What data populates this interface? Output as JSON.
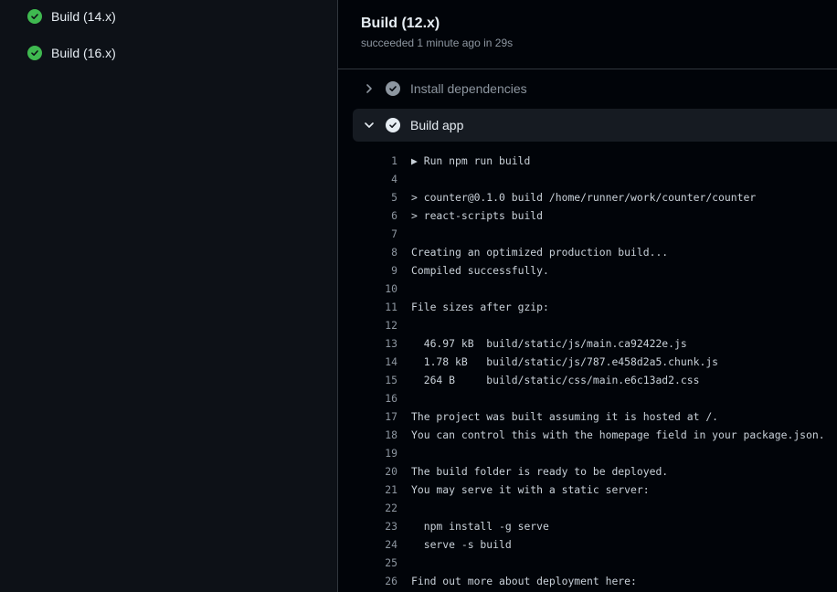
{
  "sidebar": {
    "jobs": [
      {
        "label": "Build (14.x)"
      },
      {
        "label": "Build (16.x)"
      }
    ]
  },
  "colors": {
    "success": "#3fb950",
    "background": "#010409",
    "sidebar_bg": "#0d1117",
    "border": "#30363d",
    "muted": "#8d96a0"
  },
  "header": {
    "title": "Build (12.x)",
    "subtitle": "succeeded 1 minute ago in 29s"
  },
  "steps": [
    {
      "label": "Install dependencies",
      "expanded": false,
      "icon": "chevron-right-icon"
    },
    {
      "label": "Build app",
      "expanded": true,
      "icon": "chevron-down-icon"
    }
  ],
  "log": [
    {
      "n": "1",
      "text": "▶ Run npm run build"
    },
    {
      "n": "4",
      "text": ""
    },
    {
      "n": "5",
      "text": "> counter@0.1.0 build /home/runner/work/counter/counter"
    },
    {
      "n": "6",
      "text": "> react-scripts build"
    },
    {
      "n": "7",
      "text": ""
    },
    {
      "n": "8",
      "text": "Creating an optimized production build..."
    },
    {
      "n": "9",
      "text": "Compiled successfully."
    },
    {
      "n": "10",
      "text": ""
    },
    {
      "n": "11",
      "text": "File sizes after gzip:"
    },
    {
      "n": "12",
      "text": ""
    },
    {
      "n": "13",
      "text": "  46.97 kB  build/static/js/main.ca92422e.js"
    },
    {
      "n": "14",
      "text": "  1.78 kB   build/static/js/787.e458d2a5.chunk.js"
    },
    {
      "n": "15",
      "text": "  264 B     build/static/css/main.e6c13ad2.css"
    },
    {
      "n": "16",
      "text": ""
    },
    {
      "n": "17",
      "text": "The project was built assuming it is hosted at /."
    },
    {
      "n": "18",
      "text": "You can control this with the homepage field in your package.json."
    },
    {
      "n": "19",
      "text": ""
    },
    {
      "n": "20",
      "text": "The build folder is ready to be deployed."
    },
    {
      "n": "21",
      "text": "You may serve it with a static server:"
    },
    {
      "n": "22",
      "text": ""
    },
    {
      "n": "23",
      "text": "  npm install -g serve"
    },
    {
      "n": "24",
      "text": "  serve -s build"
    },
    {
      "n": "25",
      "text": ""
    },
    {
      "n": "26",
      "text": "Find out more about deployment here:"
    }
  ]
}
